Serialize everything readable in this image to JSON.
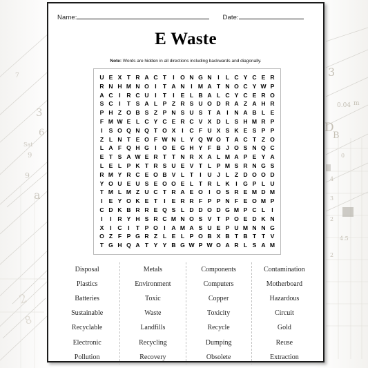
{
  "page": {
    "name_label": "Name:",
    "date_label": "Date:",
    "title": "E Waste",
    "note_prefix": "Note:",
    "note_text": " Words are hidden in all directions including backwards and diagonally."
  },
  "colors": {
    "page_background": "#ffffff",
    "page_border": "#1a1a1a",
    "text": "#000000",
    "grid_border": "#b9b9b9",
    "word_text": "#232323",
    "separator": "#c2c2c2"
  },
  "grid": {
    "rows": 18,
    "cols": 19,
    "letters": [
      [
        "U",
        "E",
        "X",
        "T",
        "R",
        "A",
        "C",
        "T",
        "I",
        "O",
        "N",
        "G",
        "N",
        "I",
        "L",
        "C",
        "Y",
        "C",
        "E",
        "R"
      ],
      [
        "R",
        "N",
        "H",
        "M",
        "N",
        "O",
        "I",
        "T",
        "A",
        "N",
        "I",
        "M",
        "A",
        "T",
        "N",
        "O",
        "C",
        "Y",
        "W",
        "P"
      ],
      [
        "A",
        "C",
        "I",
        "R",
        "C",
        "U",
        "I",
        "T",
        "I",
        "E",
        "L",
        "B",
        "A",
        "L",
        "C",
        "Y",
        "C",
        "E",
        "R",
        "O"
      ],
      [
        "S",
        "C",
        "I",
        "T",
        "S",
        "A",
        "L",
        "P",
        "Z",
        "R",
        "S",
        "U",
        "O",
        "D",
        "R",
        "A",
        "Z",
        "A",
        "H",
        "R"
      ],
      [
        "P",
        "H",
        "Z",
        "O",
        "B",
        "S",
        "Z",
        "P",
        "N",
        "S",
        "U",
        "S",
        "T",
        "A",
        "I",
        "N",
        "A",
        "B",
        "L",
        "E"
      ],
      [
        "F",
        "M",
        "W",
        "E",
        "L",
        "C",
        "Y",
        "C",
        "E",
        "R",
        "C",
        "V",
        "X",
        "D",
        "L",
        "S",
        "H",
        "M",
        "R",
        "P"
      ],
      [
        "I",
        "S",
        "O",
        "Q",
        "N",
        "Q",
        "T",
        "O",
        "X",
        "I",
        "C",
        "F",
        "U",
        "X",
        "S",
        "K",
        "E",
        "S",
        "P",
        "P"
      ],
      [
        "Z",
        "L",
        "N",
        "T",
        "E",
        "O",
        "F",
        "W",
        "N",
        "L",
        "Y",
        "Q",
        "W",
        "O",
        "T",
        "A",
        "C",
        "T",
        "Z",
        "O"
      ],
      [
        "L",
        "A",
        "F",
        "Q",
        "H",
        "G",
        "I",
        "O",
        "E",
        "G",
        "H",
        "Y",
        "F",
        "B",
        "J",
        "O",
        "S",
        "N",
        "Q",
        "C"
      ],
      [
        "E",
        "T",
        "S",
        "A",
        "W",
        "E",
        "R",
        "T",
        "T",
        "N",
        "R",
        "X",
        "A",
        "L",
        "M",
        "A",
        "P",
        "E",
        "Y",
        "A"
      ],
      [
        "L",
        "E",
        "L",
        "P",
        "K",
        "T",
        "R",
        "S",
        "U",
        "E",
        "V",
        "T",
        "L",
        "P",
        "M",
        "S",
        "R",
        "N",
        "G",
        "S"
      ],
      [
        "R",
        "M",
        "Y",
        "R",
        "C",
        "E",
        "O",
        "B",
        "V",
        "L",
        "T",
        "I",
        "U",
        "J",
        "L",
        "Z",
        "D",
        "O",
        "O",
        "D"
      ],
      [
        "Y",
        "O",
        "U",
        "E",
        "U",
        "S",
        "E",
        "O",
        "O",
        "E",
        "L",
        "T",
        "R",
        "L",
        "K",
        "I",
        "G",
        "P",
        "L",
        "U"
      ],
      [
        "T",
        "M",
        "L",
        "M",
        "Z",
        "U",
        "C",
        "T",
        "R",
        "A",
        "E",
        "O",
        "I",
        "O",
        "S",
        "R",
        "E",
        "M",
        "D",
        "M"
      ],
      [
        "I",
        "E",
        "Y",
        "O",
        "K",
        "E",
        "T",
        "I",
        "E",
        "R",
        "R",
        "F",
        "P",
        "P",
        "N",
        "F",
        "E",
        "O",
        "M",
        "P"
      ],
      [
        "C",
        "D",
        "K",
        "B",
        "R",
        "R",
        "E",
        "Q",
        "S",
        "L",
        "D",
        "D",
        "O",
        "D",
        "G",
        "M",
        "P",
        "C",
        "L",
        "I"
      ],
      [
        "I",
        "I",
        "R",
        "Y",
        "H",
        "S",
        "R",
        "C",
        "M",
        "N",
        "O",
        "S",
        "V",
        "T",
        "P",
        "O",
        "E",
        "D",
        "K",
        "N"
      ],
      [
        "X",
        "I",
        "C",
        "I",
        "T",
        "P",
        "O",
        "I",
        "A",
        "M",
        "A",
        "S",
        "U",
        "E",
        "P",
        "U",
        "M",
        "N",
        "N",
        "G"
      ],
      [
        "O",
        "Z",
        "F",
        "P",
        "G",
        "R",
        "Z",
        "L",
        "E",
        "L",
        "P",
        "O",
        "B",
        "X",
        "B",
        "T",
        "B",
        "T",
        "T",
        "V"
      ],
      [
        "T",
        "G",
        "H",
        "Q",
        "A",
        "T",
        "Y",
        "Y",
        "B",
        "G",
        "W",
        "P",
        "W",
        "O",
        "A",
        "R",
        "L",
        "S",
        "A",
        "M"
      ]
    ]
  },
  "word_list": {
    "columns": [
      [
        "Disposal",
        "Plastics",
        "Batteries",
        "Sustainable",
        "Recyclable",
        "Electronic",
        "Pollution"
      ],
      [
        "Metals",
        "Environment",
        "Toxic",
        "Waste",
        "Landfills",
        "Recycling",
        "Recovery"
      ],
      [
        "Components",
        "Computers",
        "Copper",
        "Toxicity",
        "Recycle",
        "Dumping",
        "Obsolete"
      ],
      [
        "Contamination",
        "Motherboard",
        "Hazardous",
        "Circuit",
        "Gold",
        "Reuse",
        "Extraction"
      ]
    ]
  }
}
